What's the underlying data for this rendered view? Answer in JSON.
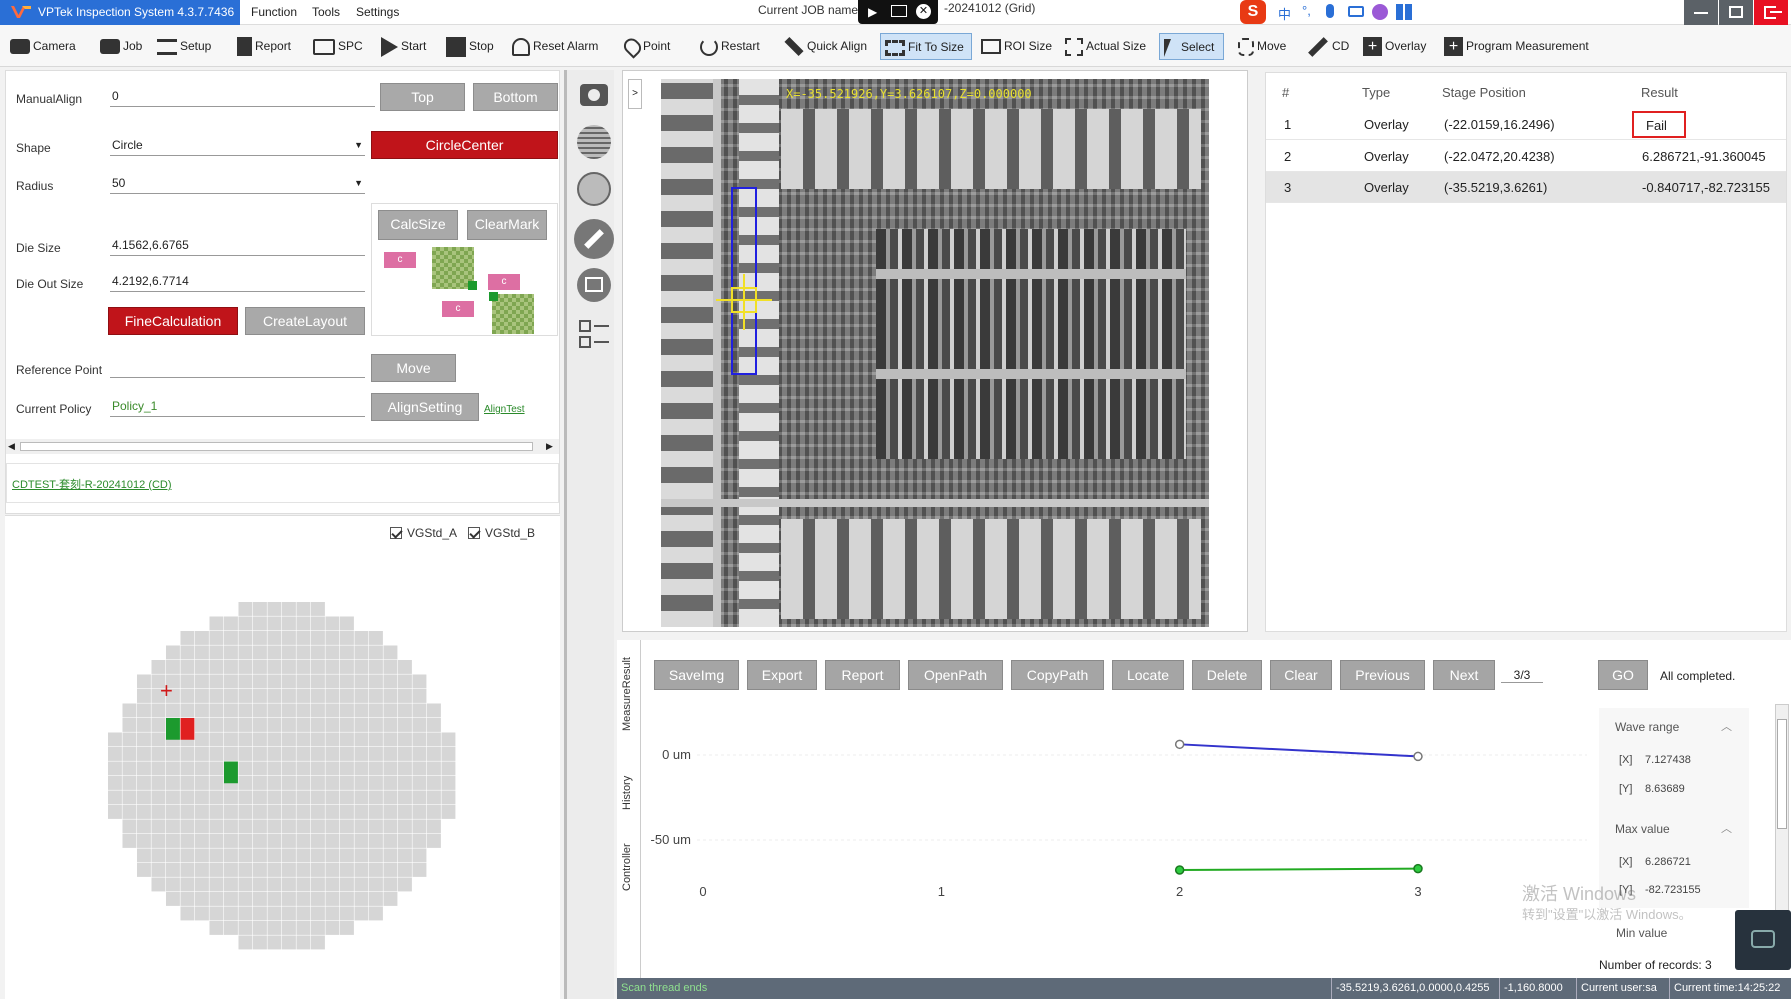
{
  "app": {
    "title": "VPTek Inspection System 4.3.7.7436",
    "menu": [
      "Function",
      "Tools",
      "Settings"
    ],
    "job_label": "Current JOB name",
    "job_suffix": "-20241012 (Grid)"
  },
  "toolbar": {
    "camera": "Camera",
    "job": "Job",
    "setup": "Setup",
    "report": "Report",
    "spc": "SPC",
    "start": "Start",
    "stop": "Stop",
    "reset_alarm": "Reset Alarm",
    "point": "Point",
    "restart": "Restart",
    "quick_align": "Quick Align",
    "fit_to_size": "Fit To Size",
    "roi_size": "ROI Size",
    "actual_size": "Actual Size",
    "select": "Select",
    "move": "Move",
    "cd": "CD",
    "overlay": "Overlay",
    "program_measurement": "Program Measurement"
  },
  "align": {
    "manual_align_label": "ManualAlign",
    "manual_align_value": "0",
    "top_btn": "Top",
    "bottom_btn": "Bottom",
    "shape_label": "Shape",
    "shape_value": "Circle",
    "circle_center_btn": "CircleCenter",
    "radius_label": "Radius",
    "radius_value": "50",
    "calc_size_btn": "CalcSize",
    "clear_mark_btn": "ClearMark",
    "die_size_label": "Die Size",
    "die_size_value": "4.1562,6.6765",
    "die_out_label": "Die Out Size",
    "die_out_value": "4.2192,6.7714",
    "fine_calc_btn": "FineCalculation",
    "create_layout_btn": "CreateLayout",
    "ref_point_label": "Reference Point",
    "ref_point_value": "",
    "move_btn": "Move",
    "policy_label": "Current Policy",
    "policy_value": "Policy_1",
    "align_setting_btn": "AlignSetting",
    "align_test_link": "AlignTest",
    "tag_c": "c"
  },
  "recipe": {
    "link": "CDTEST-套刻-R-20241012 (CD)"
  },
  "map": {
    "legend": [
      "VGStd_A",
      "VGStd_B"
    ],
    "marker": "+"
  },
  "viewer": {
    "collapse": ">",
    "coords": "X=-35.521926,Y=3.626107,Z=0.000000"
  },
  "results": {
    "headers": [
      "#",
      "Type",
      "Stage Position",
      "Result"
    ],
    "rows": [
      {
        "n": "1",
        "type": "Overlay",
        "pos": "(-22.0159,16.2496)",
        "result": "Fail"
      },
      {
        "n": "2",
        "type": "Overlay",
        "pos": "(-22.0472,20.4238)",
        "result": "6.286721,-91.360045"
      },
      {
        "n": "3",
        "type": "Overlay",
        "pos": "(-35.5219,3.6261)",
        "result": "-0.840717,-82.723155"
      }
    ]
  },
  "bottom": {
    "buttons": [
      "SaveImg",
      "Export",
      "Report",
      "OpenPath",
      "CopyPath",
      "Locate",
      "Delete",
      "Clear",
      "Previous",
      "Next"
    ],
    "page": "3/3",
    "go": "GO",
    "status": "All completed.",
    "tabs": [
      "MeasureResult",
      "History",
      "Controller"
    ],
    "y_labels": [
      "0 um",
      "-50 um"
    ],
    "x_labels": [
      "0",
      "1",
      "2",
      "3"
    ],
    "stats": {
      "wave_range": "Wave range",
      "wave_x": "7.127438",
      "wave_y": "8.63689",
      "max_value": "Max value",
      "max_x": "6.286721",
      "max_y": "-82.723155",
      "min_value": "Min value",
      "x_tag": "[X]",
      "y_tag": "[Y]"
    },
    "records": "Number of records: 3",
    "watermark1": "激活 Windows",
    "watermark2": "转到\"设置\"以激活 Windows。"
  },
  "chart_data": {
    "type": "line",
    "x": [
      2,
      3
    ],
    "series": [
      {
        "values": [
          6.286721,
          -0.840717
        ],
        "color": "#3333cc"
      },
      {
        "values": [
          -91.360045,
          -82.723155
        ],
        "color": "#22aa22"
      }
    ],
    "xlim": [
      0,
      3
    ],
    "ytick_labels": [
      "0 um",
      "-50 um"
    ]
  },
  "statusbar": {
    "left": "Scan thread ends",
    "pos": "-35.5219,3.6261,0.0000,0.4255",
    "pos2": "-1,160.8000",
    "user": "Current user:sa",
    "time": "Current time:14:25:22"
  },
  "colors": {
    "accent": "#2a6fd6",
    "danger": "#c0141a",
    "fail": "#e02020",
    "pass": "#1c9a2e"
  }
}
